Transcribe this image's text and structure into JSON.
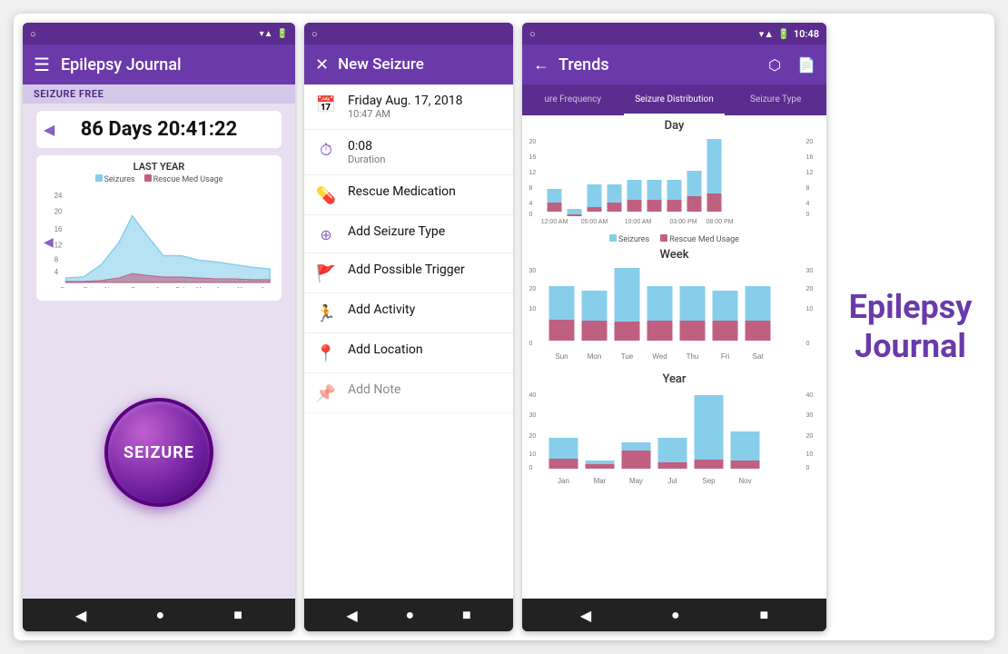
{
  "app": {
    "title": "Epilepsy Journal",
    "branding_line1": "Epilepsy",
    "branding_line2": "Journal"
  },
  "phone1": {
    "status_left": "○",
    "status_icons": "▾▲ 🔋",
    "app_title": "Epilepsy Journal",
    "seizure_free": "SEIZURE FREE",
    "days_counter": "86 Days 20:41:22",
    "chart_title": "LAST YEAR",
    "legend_seizures": "Seizures",
    "legend_rescue": "Rescue Med Usage",
    "x_labels": [
      "Sep",
      "Oct",
      "Nov",
      "Dec",
      "Jan",
      "Feb",
      "Mar",
      "Apr",
      "May",
      "Jun"
    ],
    "seizure_button": "SEIZURE"
  },
  "phone2": {
    "status_left": "○",
    "header_title": "New Seizure",
    "close_icon": "✕",
    "form_items": [
      {
        "icon": "📅",
        "main": "Friday Aug. 17, 2018",
        "sub": "10:47 AM",
        "gray": false
      },
      {
        "icon": "⏱",
        "main": "0:08",
        "sub": "Duration",
        "gray": false
      },
      {
        "icon": "💊",
        "main": "Rescue Medication",
        "sub": "",
        "gray": false
      },
      {
        "icon": "❓",
        "main": "Add Seizure Type",
        "sub": "",
        "gray": false
      },
      {
        "icon": "🚩",
        "main": "Add Possible Trigger",
        "sub": "",
        "gray": false
      },
      {
        "icon": "🏃",
        "main": "Add Activity",
        "sub": "",
        "gray": false
      },
      {
        "icon": "📍",
        "main": "Add Location",
        "sub": "",
        "gray": false
      },
      {
        "icon": "📌",
        "main": "Add Note",
        "sub": "",
        "gray": true
      }
    ]
  },
  "phone3": {
    "status_right": "10:48",
    "app_title": "Trends",
    "tabs": [
      {
        "label": "ure Frequency",
        "active": false
      },
      {
        "label": "Seizure Distribution",
        "active": true
      },
      {
        "label": "Seizure Type",
        "active": false
      }
    ],
    "sections": [
      {
        "title": "Day",
        "x_labels": [
          "12:00 AM",
          "05:00 AM",
          "10:00 AM",
          "03:00 PM",
          "08:00 PM"
        ],
        "blue_bars": [
          6,
          2,
          8,
          8,
          8,
          8,
          8,
          12,
          20
        ],
        "red_bars": [
          2,
          0,
          1,
          2,
          4,
          4,
          4,
          4,
          4
        ],
        "y_max": 20
      },
      {
        "title": "Week",
        "x_labels": [
          "Sun",
          "Mon",
          "Tue",
          "Wed",
          "Thu",
          "Fri",
          "Sat"
        ],
        "blue_bars": [
          20,
          18,
          30,
          22,
          22,
          18,
          20
        ],
        "red_bars": [
          8,
          8,
          8,
          8,
          8,
          8,
          8
        ],
        "y_max": 30
      },
      {
        "title": "Year",
        "x_labels": [
          "Jan",
          "Mar",
          "May",
          "Jul",
          "Sep",
          "Nov"
        ],
        "blue_bars": [
          14,
          4,
          10,
          14,
          36,
          18
        ],
        "red_bars": [
          4,
          2,
          8,
          2,
          4,
          2
        ],
        "y_max": 40
      }
    ],
    "legend_seizures": "Seizures",
    "legend_rescue": "Rescue Med Usage"
  }
}
